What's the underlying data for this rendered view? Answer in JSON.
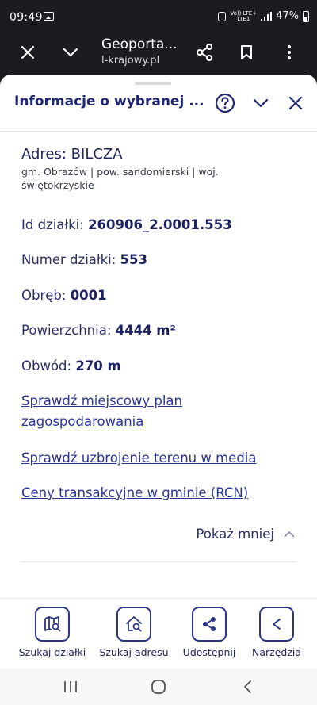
{
  "status_bar": {
    "time": "09:49",
    "network_top": "Vo)) LTE+",
    "network_bottom": "LTE1",
    "battery": "47%"
  },
  "browser": {
    "title": "Geoporta...",
    "url": "l-krajowy.pl",
    "icons": [
      "close-icon",
      "chevron-down-icon",
      "share-icon",
      "bookmark-icon",
      "more-icon"
    ]
  },
  "sheet": {
    "title": "Informacje o wybranej ...",
    "address_title": "Adres: BILCZA",
    "address_sub": "gm. Obrazów | pow. sandomierski | woj. świętokrzyskie",
    "fields": [
      {
        "label": "Id działki:",
        "value": "260906_2.0001.553"
      },
      {
        "label": "Numer działki:",
        "value": "553"
      },
      {
        "label": "Obręb:",
        "value": "0001"
      },
      {
        "label": "Powierzchnia:",
        "value": "4444 m²"
      },
      {
        "label": "Obwód:",
        "value": "270 m"
      }
    ],
    "links": {
      "plan_line1": "Sprawdź miejscowy plan",
      "plan_line2": "zagospodarowania",
      "media": "Sprawdź uzbrojenie terenu w media",
      "rcn": "Ceny transakcyjne w gminie (RCN)"
    },
    "show_less": "Pokaż mniej"
  },
  "toolbar": [
    {
      "label": "Szukaj działki",
      "icon": "map-search-icon"
    },
    {
      "label": "Szukaj adresu",
      "icon": "home-search-icon"
    },
    {
      "label": "Udostępnij",
      "icon": "share-icon"
    },
    {
      "label": "Narzędzia",
      "icon": "back-arrow-icon"
    }
  ],
  "colors": {
    "accent": "#2c3585",
    "text": "#1f2770",
    "link": "#2a3593",
    "browser_bar": "#1c1c20"
  }
}
